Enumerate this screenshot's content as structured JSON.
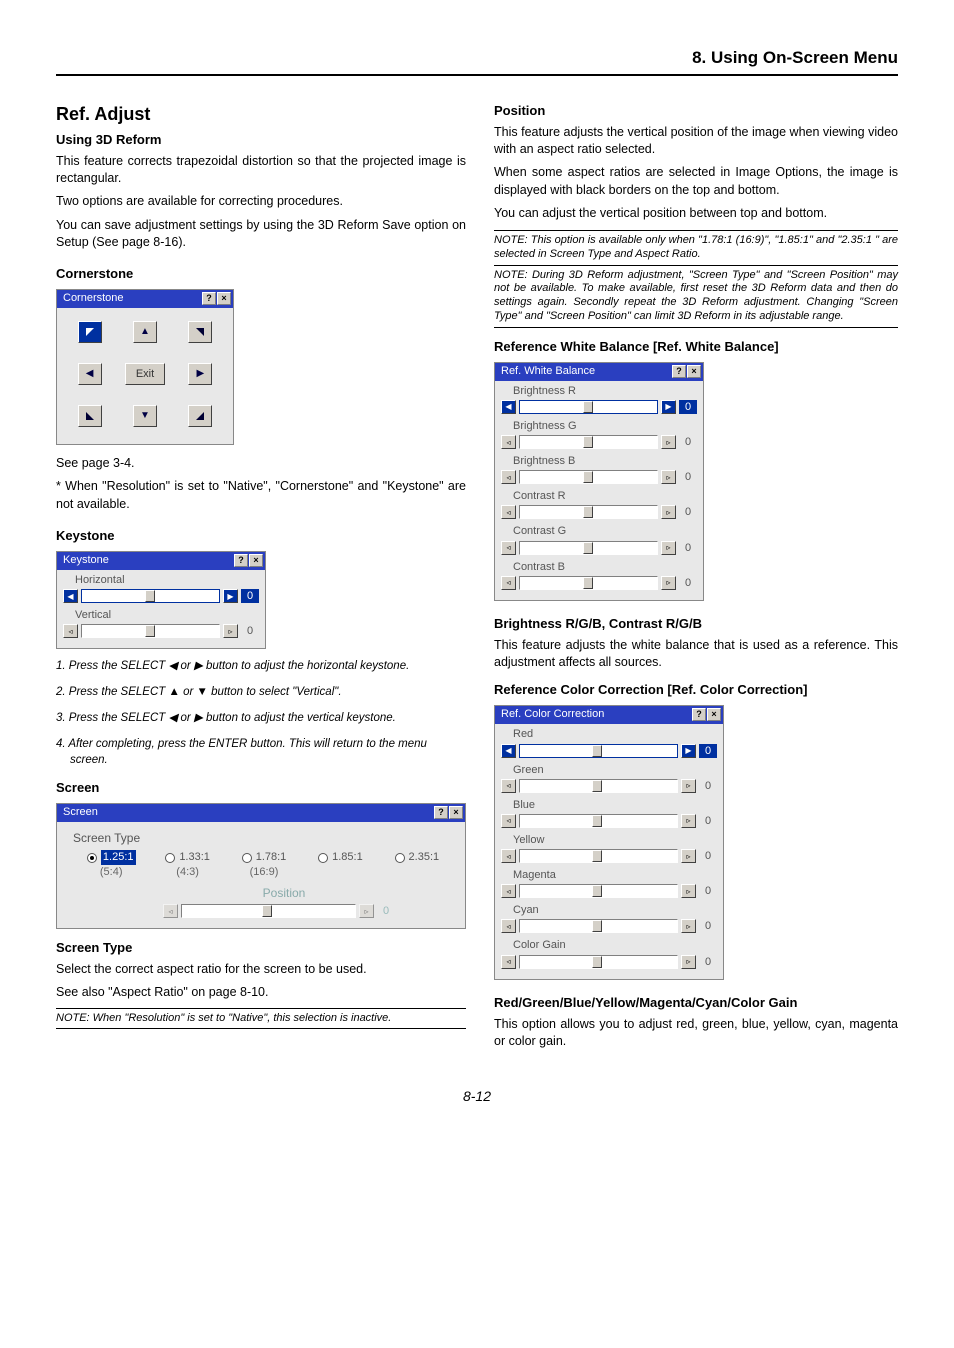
{
  "header": {
    "chapter": "8. Using On-Screen Menu"
  },
  "pageNumber": "8-12",
  "left": {
    "h1": "Ref. Adjust",
    "h2a": "Using 3D Reform",
    "p1": "This feature corrects trapezoidal distortion so that the projected image is rectangular.",
    "p2": "Two options are available for correcting procedures.",
    "p3": "You can save adjustment settings by using the 3D Reform Save option on Setup (See page 8-16).",
    "h3a": "Cornerstone",
    "csTitle": "Cornerstone",
    "csExit": "Exit",
    "p4": "See page 3-4.",
    "p5": "* When \"Resolution\" is set to \"Native\", \"Cornerstone\" and \"Keystone\" are not available.",
    "h3b": "Keystone",
    "ksTitle": "Keystone",
    "ksHoriz": "Horizontal",
    "ksVert": "Vertical",
    "ksVal0": "0",
    "step1": "1.  Press the SELECT ◀ or ▶ button to adjust the horizontal keystone.",
    "step2": "2.  Press the SELECT ▲ or ▼ button to select \"Vertical\".",
    "step3": "3.  Press the SELECT ◀ or ▶ button to adjust the vertical keystone.",
    "step4": "4.  After completing, press the ENTER button. This will return to the menu screen.",
    "h2b": "Screen",
    "scTitle": "Screen",
    "scTypeLabel": "Screen Type",
    "ratios": [
      {
        "r": "1.25:1",
        "s": "(5:4)",
        "sel": true
      },
      {
        "r": "1.33:1",
        "s": "(4:3)"
      },
      {
        "r": "1.78:1",
        "s": "(16:9)"
      },
      {
        "r": "1.85:1",
        "s": ""
      },
      {
        "r": "2.35:1",
        "s": ""
      }
    ],
    "scPosLabel": "Position",
    "scPosVal": "0",
    "h3c": "Screen Type",
    "p6": "Select the correct aspect ratio for the screen to be used.",
    "p7": "See also \"Aspect Ratio\" on page 8-10.",
    "note1": "NOTE: When \"Resolution\" is set to \"Native\", this selection is inactive."
  },
  "right": {
    "h3a": "Position",
    "p1": "This feature adjusts the vertical position of the image when viewing video with an aspect ratio selected.",
    "p2": "When some aspect ratios are selected in Image Options, the image is displayed with black borders on the top and bottom.",
    "p3": "You can adjust the vertical position between top and bottom.",
    "note1": "NOTE: This option is available only when \"1.78:1 (16:9)\", \"1.85:1\" and \"2.35:1 \" are selected in Screen Type and Aspect Ratio.",
    "note2": "NOTE: During 3D Reform adjustment, \"Screen Type\" and \"Screen Position\" may not be available. To make available, first reset the 3D Reform data and then do settings again. Secondly repeat the 3D Reform adjustment. Changing \"Screen Type\" and \"Screen Position\" can limit 3D Reform in its adjustable range.",
    "h2a": "Reference White Balance [Ref. White Balance]",
    "wbTitle": "Ref. White Balance",
    "wbRows": [
      "Brightness R",
      "Brightness G",
      "Brightness B",
      "Contrast R",
      "Contrast G",
      "Contrast B"
    ],
    "wbVal": "0",
    "h3b": "Brightness R/G/B, Contrast R/G/B",
    "p4": "This feature adjusts the white balance that is used as a reference. This adjustment affects all sources.",
    "h2b": "Reference Color Correction [Ref. Color Correction]",
    "ccTitle": "Ref. Color Correction",
    "ccRows": [
      "Red",
      "Green",
      "Blue",
      "Yellow",
      "Magenta",
      "Cyan",
      "Color Gain"
    ],
    "ccVal": "0",
    "h3c": "Red/Green/Blue/Yellow/Magenta/Cyan/Color Gain",
    "p5": "This option allows you to adjust red, green, blue, yellow, cyan, magenta or color gain."
  }
}
